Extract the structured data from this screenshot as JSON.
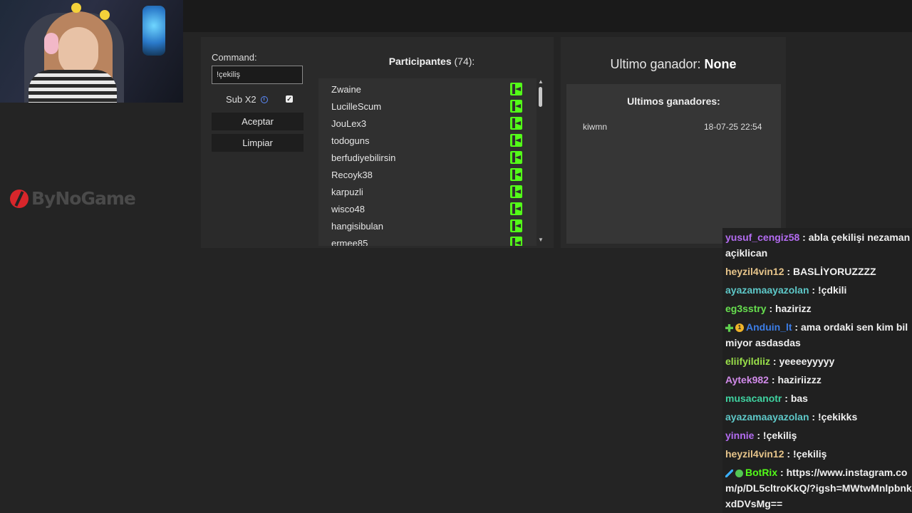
{
  "brand": {
    "text": "ByNoGame",
    "accent": "#d8262b"
  },
  "left": {
    "command_label": "Command:",
    "command_value": "!çekiliş",
    "sub_label": "Sub X2",
    "sub_checked": true,
    "accept_label": "Aceptar",
    "clear_label": "Limpiar"
  },
  "participants": {
    "title": "Participantes",
    "count": "(74):",
    "names": [
      "Zwaine",
      "LucilleScum",
      "JouLex3",
      "todoguns",
      "berfudiyebilirsin",
      "Recoyk38",
      "karpuzli",
      "wisco48",
      "hangisibulan",
      "ermee85"
    ],
    "platform_color": "#53fc18"
  },
  "winner": {
    "label": "Ultimo ganador:",
    "value": "None",
    "history_title": "Ultimos ganadores:",
    "history": [
      {
        "name": "kiwmn",
        "date": "18-07-25 22:54"
      }
    ]
  },
  "chat": [
    {
      "user": "yusuf_cengiz58",
      "color": "#b46cf2",
      "text": "abla çekilişi nezaman açiklican"
    },
    {
      "user": "heyzil4vin12",
      "color": "#e6c48a",
      "text": "BASLİYORUZZZZ"
    },
    {
      "user": "ayazamaayazolan",
      "color": "#5ec8c8",
      "text": "!çdkili"
    },
    {
      "user": "eg3sstry",
      "color": "#67e04f",
      "text": "hazirizz"
    },
    {
      "user": "Anduin_lt",
      "color": "#3c7de6",
      "text": "ama ordaki sen kim bilmiyor asdasdas",
      "badges": [
        "green-plus-badge",
        "gold-sub-badge"
      ],
      "badge_num": "1"
    },
    {
      "user": "eliifyildiiz",
      "color": "#9ae04a",
      "text": "yeeeeyyyyy"
    },
    {
      "user": "Aytek982",
      "color": "#d08ae8",
      "text": "haziriizzz"
    },
    {
      "user": "musacanotr",
      "color": "#3fd2a0",
      "text": "bas"
    },
    {
      "user": "ayazamaayazolan",
      "color": "#5ec8c8",
      "text": "!çekikks"
    },
    {
      "user": "yinnie",
      "color": "#b46cf2",
      "text": "!çekiliş"
    },
    {
      "user": "heyzil4vin12",
      "color": "#e6c48a",
      "text": "!çekiliş"
    },
    {
      "user": "BotRix",
      "color": "#53fc18",
      "text": "https://www.instagram.com/p/DL5cltroKkQ/?igsh=MWtwMnlpbnkxdDVsMg==",
      "badges": [
        "sword-badge",
        "verified-badge"
      ]
    }
  ]
}
